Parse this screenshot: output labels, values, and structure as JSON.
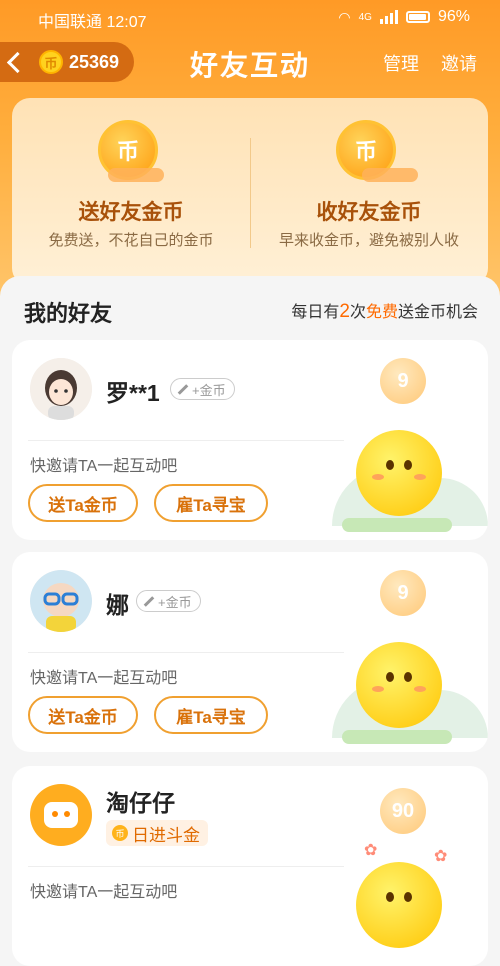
{
  "status_bar": {
    "carrier_time": "中国联通 12:07",
    "network": "4G",
    "battery": "96%"
  },
  "header": {
    "coins": "25369",
    "title": "好友互动",
    "manage": "管理",
    "invite": "邀请"
  },
  "actions": [
    {
      "title": "送好友金币",
      "subtitle": "免费送，不花自己的金币",
      "icon": "coin-gift-icon"
    },
    {
      "title": "收好友金币",
      "subtitle": "早来收金币，避免被别人收",
      "icon": "coin-collect-icon"
    }
  ],
  "friends_section": {
    "title": "我的好友",
    "note_prefix": "每日有",
    "note_count": "2",
    "note_mid": "次",
    "note_free": "免费",
    "note_suffix": "送金币机会"
  },
  "friends": [
    {
      "name": "罗**1",
      "tag": "+金币",
      "level": "9",
      "invite_text": "快邀请TA一起互动吧",
      "btn_send": "送Ta金币",
      "btn_hire": "雇Ta寻宝"
    },
    {
      "name": "娜",
      "tag": "+金币",
      "level": "9",
      "invite_text": "快邀请TA一起互动吧",
      "btn_send": "送Ta金币",
      "btn_hire": "雇Ta寻宝"
    },
    {
      "name": "淘仔仔",
      "tag": "日进斗金",
      "level": "90",
      "invite_text": "快邀请TA一起互动吧"
    }
  ],
  "colors": {
    "accent": "#ff9a26",
    "button_text": "#d9720b"
  }
}
